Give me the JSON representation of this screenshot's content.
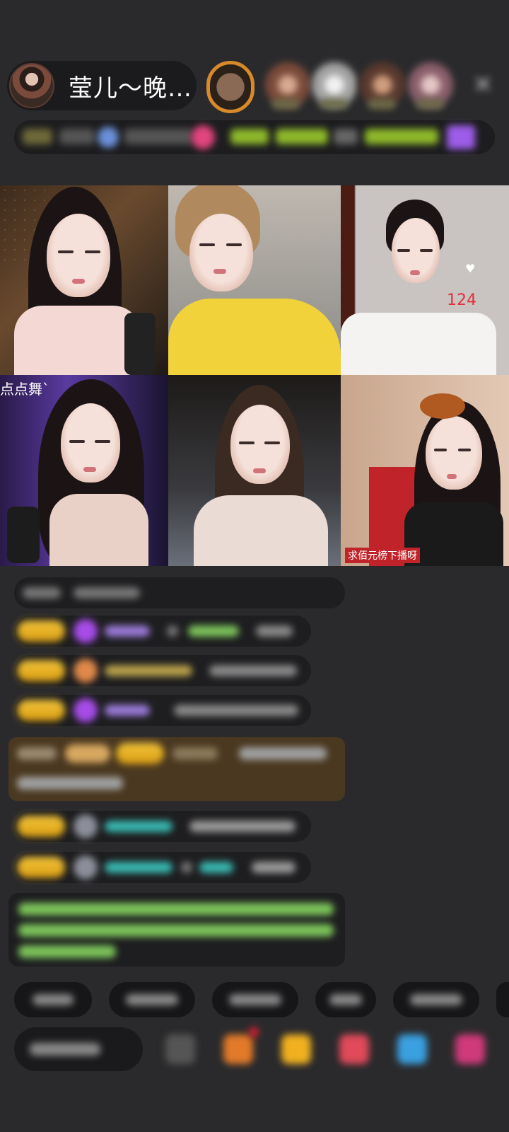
{
  "header": {
    "host_name": "莹儿～晚…",
    "close_icon": "close-icon"
  },
  "grid": {
    "tiles": [
      {
        "name": "stream-tile-1"
      },
      {
        "name": "stream-tile-2"
      },
      {
        "name": "stream-tile-3",
        "overlay_number": "124"
      },
      {
        "name": "stream-tile-4",
        "overlay_text": "点点舞`"
      },
      {
        "name": "stream-tile-5"
      },
      {
        "name": "stream-tile-6",
        "overlay_text": "求佰元榜下播呀"
      }
    ]
  },
  "colors": {
    "background": "#2a2a2c",
    "badge_gold": "#f2c43a",
    "gem_purple": "#a64ce8",
    "chat_green": "#7cc35a",
    "chat_teal": "#39b7b0"
  }
}
